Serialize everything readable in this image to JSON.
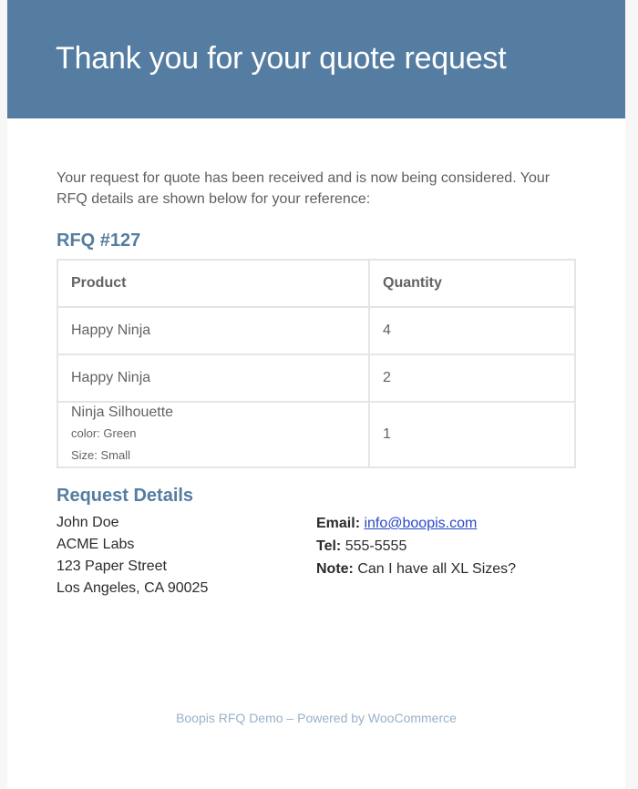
{
  "header": {
    "title": "Thank you for your quote request"
  },
  "intro": "Your request for quote has been received and is now being considered. Your RFQ details are shown below for your reference:",
  "rfq": {
    "title": "RFQ #127",
    "columns": [
      "Product",
      "Quantity"
    ],
    "items": [
      {
        "product": "Happy Ninja",
        "quantity": "4"
      },
      {
        "product": "Happy Ninja",
        "quantity": "2"
      },
      {
        "product": "Ninja Silhouette",
        "meta1": "color: Green",
        "meta2": "Size: Small",
        "quantity": "1"
      }
    ]
  },
  "details": {
    "title": "Request Details",
    "address": [
      "John Doe",
      "ACME Labs",
      "123 Paper Street",
      "Los Angeles, CA 90025"
    ],
    "email_label": "Email:",
    "email": "info@boopis.com",
    "tel_label": "Tel:",
    "tel": "555-5555",
    "note_label": "Note:",
    "note": "Can I have all XL Sizes?"
  },
  "footer": "Boopis RFQ Demo – Powered by WooCommerce",
  "colors": {
    "header_bg": "#557da1",
    "heading": "#557da1",
    "link": "#2a48c9",
    "footer_text": "#99b1c7"
  }
}
